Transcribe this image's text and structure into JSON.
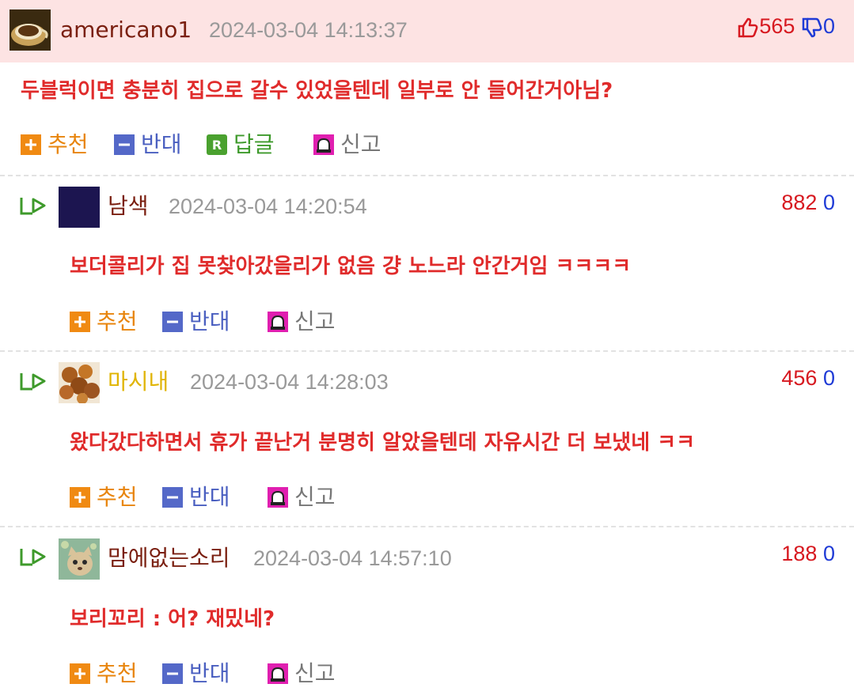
{
  "comments": [
    {
      "nickname": "americano1",
      "nick_color": "#7a1f10",
      "time": "2024-03-04 14:13:37",
      "up": "565",
      "down": "0",
      "text": "두블럭이면 충분히 집으로 갈수 있었을텐데 일부로 안 들어간거아님?",
      "actions": {
        "recommend": "추천",
        "oppose": "반대",
        "reply": "답글",
        "report": "신고"
      }
    },
    {
      "nickname": "남색",
      "nick_color": "#7a1f10",
      "time": "2024-03-04 14:20:54",
      "up": "882",
      "down": "0",
      "text": "보더콜리가 집 못찾아갔을리가 없음 걍 노느라 안간거임 ㅋㅋㅋㅋ",
      "actions": {
        "recommend": "추천",
        "oppose": "반대",
        "report": "신고"
      }
    },
    {
      "nickname": "마시내",
      "nick_color": "#e0b400",
      "time": "2024-03-04 14:28:03",
      "up": "456",
      "down": "0",
      "text": "왔다갔다하면서 휴가 끝난거 분명히 알았을텐데 자유시간 더 보냈네 ㅋㅋ",
      "actions": {
        "recommend": "추천",
        "oppose": "반대",
        "report": "신고"
      }
    },
    {
      "nickname": "맘에없는소리",
      "nick_color": "#7a1f10",
      "time": "2024-03-04 14:57:10",
      "up": "188",
      "down": "0",
      "text": "보리꼬리 : 어? 재밌네?",
      "actions": {
        "recommend": "추천",
        "oppose": "반대",
        "report": "신고"
      }
    }
  ],
  "icons": {
    "thumbs_up": "thumbs-up-icon",
    "thumbs_down": "thumbs-down-icon",
    "reply_arrow": "reply-arrow-icon",
    "recommend": "plus-icon",
    "oppose": "minus-icon",
    "reply": "reply-r-icon",
    "report": "siren-icon"
  },
  "colors": {
    "header_bg": "#fde3e3",
    "comment_text": "#e02b2b",
    "up_count": "#d71920",
    "down_count": "#1f3bd6"
  }
}
